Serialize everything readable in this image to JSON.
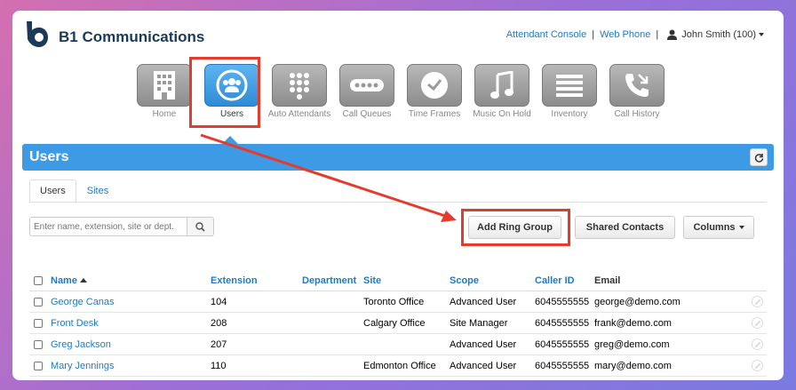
{
  "brand": {
    "name": "B1 Communications"
  },
  "toplinks": {
    "attendant": "Attendant Console",
    "divider": "|",
    "webphone": "Web Phone",
    "user": "John Smith (100)"
  },
  "apps": [
    {
      "label": "Home",
      "icon": "building-icon"
    },
    {
      "label": "Users",
      "icon": "users-icon"
    },
    {
      "label": "Auto Attendants",
      "icon": "keypad-icon"
    },
    {
      "label": "Call Queues",
      "icon": "dots-icon"
    },
    {
      "label": "Time Frames",
      "icon": "clock-icon"
    },
    {
      "label": "Music On Hold",
      "icon": "music-note-icon"
    },
    {
      "label": "Inventory",
      "icon": "list-icon"
    },
    {
      "label": "Call History",
      "icon": "phone-history-icon"
    }
  ],
  "page": {
    "title": "Users"
  },
  "tabs": {
    "users": "Users",
    "sites": "Sites"
  },
  "search": {
    "placeholder": "Enter name, extension, site or dept."
  },
  "buttons": {
    "add_ring_group": "Add Ring Group",
    "shared_contacts": "Shared Contacts",
    "columns": "Columns"
  },
  "table": {
    "headers": {
      "name": "Name",
      "extension": "Extension",
      "department": "Department",
      "site": "Site",
      "scope": "Scope",
      "caller_id": "Caller ID",
      "email": "Email"
    },
    "rows": [
      {
        "name": "George Canas",
        "extension": "104",
        "department": "",
        "site": "Toronto Office",
        "scope": "Advanced User",
        "caller_id": "6045555555",
        "email": "george@demo.com"
      },
      {
        "name": "Front Desk",
        "extension": "208",
        "department": "",
        "site": "Calgary Office",
        "scope": "Site Manager",
        "caller_id": "6045555555",
        "email": "frank@demo.com"
      },
      {
        "name": "Greg Jackson",
        "extension": "207",
        "department": "",
        "site": "",
        "scope": "Advanced User",
        "caller_id": "6045555555",
        "email": "greg@demo.com"
      },
      {
        "name": "Mary Jennings",
        "extension": "110",
        "department": "",
        "site": "Edmonton Office",
        "scope": "Advanced User",
        "caller_id": "6045555555",
        "email": "mary@demo.com"
      }
    ]
  },
  "colors": {
    "accent": "#3d9be6",
    "link": "#1f7ac2",
    "highlight": "#e53b2c"
  }
}
